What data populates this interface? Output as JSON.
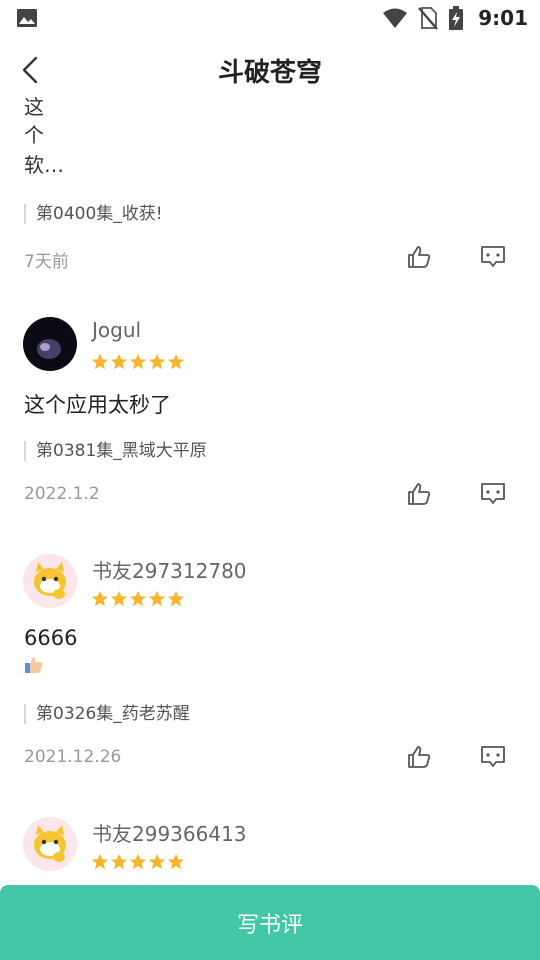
{
  "status_bar": {
    "time": "9:01"
  },
  "header": {
    "title": "斗破苍穹"
  },
  "reviews": [
    {
      "text_lines": [
        "这",
        "个",
        "软…"
      ],
      "episode": "第0400集_收获!",
      "date": "7天前"
    },
    {
      "user": "Jogul",
      "rating": 5,
      "text": "这个应用太秒了",
      "episode": "第0381集_黑域大平原",
      "date": "2022.1.2"
    },
    {
      "user": "书友297312780",
      "rating": 5,
      "text": "6666",
      "episode": "第0326集_药老苏醒",
      "date": "2021.12.26"
    },
    {
      "user": "书友299366413",
      "rating": 5
    }
  ],
  "footer": {
    "write_review_label": "写书评"
  },
  "colors": {
    "accent": "#3cc5a4",
    "star": "#f7b52c"
  }
}
